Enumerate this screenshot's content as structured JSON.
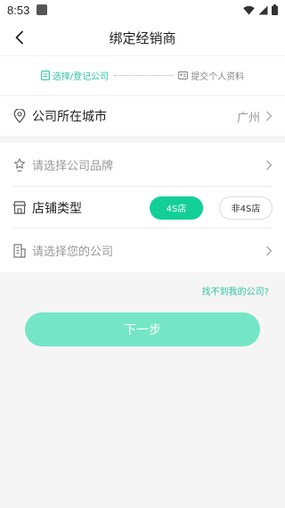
{
  "status_bar": {
    "time": "8:53"
  },
  "nav": {
    "title": "绑定经销商"
  },
  "steps": {
    "step1": "选择/登记公司",
    "step2": "提交个人资料"
  },
  "city": {
    "label": "公司所在城市",
    "value": "广州"
  },
  "form": {
    "brand_placeholder": "请选择公司品牌",
    "store_type_label": "店铺类型",
    "store_options": [
      "4S店",
      "非4S店"
    ],
    "selected_store": "4S店",
    "company_placeholder": "请选择您的公司"
  },
  "links": {
    "not_found": "找不到我的公司?"
  },
  "actions": {
    "next": "下一步"
  },
  "colors": {
    "accent": "#2ec4a2",
    "button_selected": "#12cf98",
    "next_button": "#74e6c6"
  }
}
